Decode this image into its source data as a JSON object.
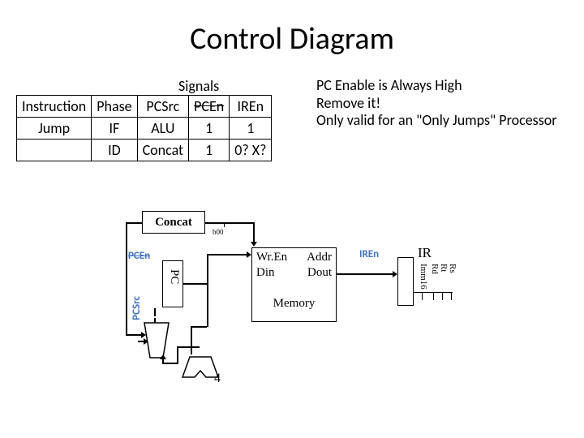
{
  "title": "Control Diagram",
  "signals_header": "Signals",
  "table": {
    "headers": {
      "instruction": "Instruction",
      "phase": "Phase",
      "pcsrc": "PCSrc",
      "pcen": "PCEn",
      "iren": "IREn"
    },
    "rows": [
      {
        "instruction": "Jump",
        "phase": "IF",
        "pcsrc": "ALU",
        "pcen": "1",
        "iren": "1"
      },
      {
        "instruction": "",
        "phase": "ID",
        "pcsrc": "Concat",
        "pcen": "1",
        "iren": "0? X?"
      }
    ]
  },
  "notes": {
    "line1": "PC Enable is Always High",
    "line2": "Remove it!",
    "line3": "Only valid for an \"Only Jumps\" Processor"
  },
  "diagram": {
    "concat": "Concat",
    "b00": "b00",
    "pc": "PC",
    "pcen": "PCEn",
    "pcsrc": "PCSrc",
    "memory": {
      "title": "Memory",
      "wren": "Wr.En",
      "addr": "Addr",
      "din": "Din",
      "dout": "Dout"
    },
    "iren": "IREn",
    "ir": "IR",
    "fields": {
      "imm16": "Imm16",
      "rd": "Rd",
      "rt": "Rt",
      "rs": "Rs"
    },
    "adder_input": "4"
  }
}
